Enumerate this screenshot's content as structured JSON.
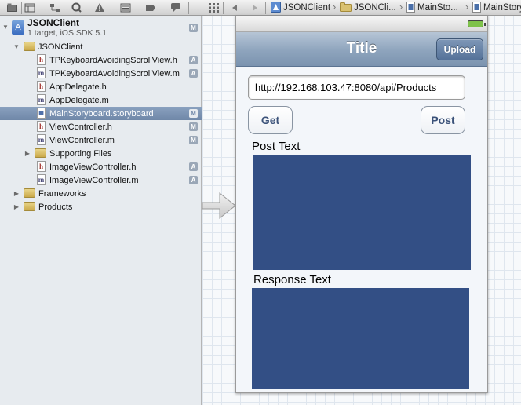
{
  "toolbar": {
    "icons": [
      "folder-icon",
      "hierarchy-icon",
      "search-icon",
      "warning-icon",
      "list-icon",
      "breakpoint-icon",
      "log-icon",
      "grid-icon",
      "back-arrow-icon",
      "forward-arrow-icon"
    ],
    "breadcrumbs": [
      "JSONClient",
      "JSONCli...",
      "MainSto...",
      "MainStory"
    ]
  },
  "navigator": {
    "project": {
      "name": "JSONClient",
      "subtitle": "1 target, iOS SDK 5.1",
      "badge": "M"
    },
    "items": [
      {
        "label": "JSONClient",
        "kind": "folder",
        "badge": ""
      },
      {
        "label": "TPKeyboardAvoidingScrollView.h",
        "kind": "h",
        "badge": "A"
      },
      {
        "label": "TPKeyboardAvoidingScrollView.m",
        "kind": "m",
        "badge": "A"
      },
      {
        "label": "AppDelegate.h",
        "kind": "h",
        "badge": ""
      },
      {
        "label": "AppDelegate.m",
        "kind": "m",
        "badge": ""
      },
      {
        "label": "MainStoryboard.storyboard",
        "kind": "storyboard",
        "badge": "M"
      },
      {
        "label": "ViewController.h",
        "kind": "h",
        "badge": "M"
      },
      {
        "label": "ViewController.m",
        "kind": "m",
        "badge": "M"
      },
      {
        "label": "Supporting Files",
        "kind": "folder",
        "badge": ""
      },
      {
        "label": "ImageViewController.h",
        "kind": "h",
        "badge": "A"
      },
      {
        "label": "ImageViewController.m",
        "kind": "m",
        "badge": "A"
      },
      {
        "label": "Frameworks",
        "kind": "folder",
        "badge": ""
      },
      {
        "label": "Products",
        "kind": "folder",
        "badge": ""
      }
    ]
  },
  "scene": {
    "nav_title": "Title",
    "upload_label": "Upload",
    "url_value": "http://192.168.103.47:8080/api/Products",
    "get_label": "Get",
    "post_label": "Post",
    "post_text_label": "Post Text",
    "response_text_label": "Response Text",
    "textview_color": "#334f85"
  },
  "colors": {
    "selection": "#7d94b4",
    "navigator_bg": "#e7ebef",
    "navbar_tint": "#8ea4bd"
  }
}
